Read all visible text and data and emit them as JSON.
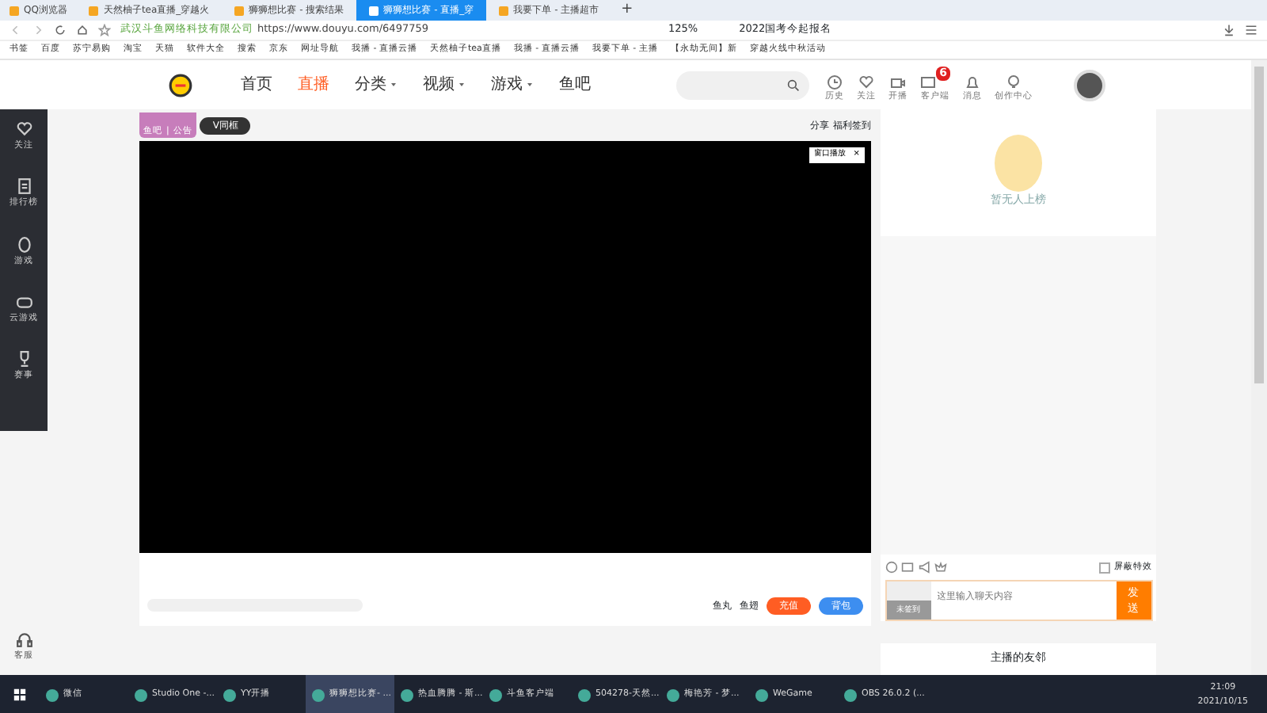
{
  "browser": {
    "tabs": [
      {
        "label": "QQ浏览器",
        "selected": false
      },
      {
        "label": "天然柚子tea直播_穿越火",
        "selected": false
      },
      {
        "label": "狮狮想比赛 - 搜索结果",
        "selected": false
      },
      {
        "label": "狮狮想比赛 - 直播_穿",
        "selected": true
      },
      {
        "label": "我要下单 - 主播超市",
        "selected": false
      }
    ],
    "new_tab": "+",
    "address": {
      "site": "武汉斗鱼网络科技有限公司",
      "url": "https://www.douyu.com/6497759"
    },
    "zoom": "125%",
    "news": "2022国考今起报名",
    "bookmarks": [
      "书签",
      "百度",
      "苏宁易购",
      "淘宝",
      "天猫",
      "软件大全",
      "搜索",
      "京东",
      "网址导航",
      "我播 - 直播云播",
      "天然柚子tea直播",
      "我播 - 直播云播",
      "我要下单 - 主播",
      "【永劫无间】新",
      "穿越火线中秋活动"
    ]
  },
  "header": {
    "nav": [
      {
        "label": "首页",
        "selected": false,
        "dropdown": false
      },
      {
        "label": "直播",
        "selected": true,
        "dropdown": false
      },
      {
        "label": "分类",
        "selected": false,
        "dropdown": true
      },
      {
        "label": "视频",
        "selected": false,
        "dropdown": true
      },
      {
        "label": "游戏",
        "selected": false,
        "dropdown": true
      },
      {
        "label": "鱼吧",
        "selected": false,
        "dropdown": false
      }
    ],
    "actions": [
      {
        "label": "历史"
      },
      {
        "label": "关注"
      },
      {
        "label": "开播"
      },
      {
        "label": "客户端",
        "badge": "6"
      },
      {
        "label": "消息"
      },
      {
        "label": "创作中心"
      }
    ]
  },
  "sidebar": [
    {
      "label": "关注"
    },
    {
      "label": "排行榜"
    },
    {
      "label": "游戏"
    },
    {
      "label": "云游戏"
    },
    {
      "label": "赛事"
    }
  ],
  "sidebar_bottom": "客服",
  "room": {
    "fishbar": "鱼吧",
    "separator": "|",
    "notice": "公告",
    "badge": "V同框",
    "share": "分享",
    "signin": "福利签到",
    "window_play": "窗口播放",
    "close": "×",
    "gifts": [
      {
        "label": "鱼丸"
      },
      {
        "label": "鱼翅"
      }
    ],
    "recharge": "充值",
    "backpack": "背包"
  },
  "chat": {
    "banner": "暂无人上榜",
    "block_effects": {
      "label": "屏蔽特效",
      "checked": false
    },
    "sign": "未签到",
    "placeholder": "这里输入聊天内容",
    "send": "发送"
  },
  "friends_title": "主播的友邻",
  "taskbar": {
    "apps": [
      {
        "label": "微信",
        "active": false
      },
      {
        "label": "Studio One -...",
        "active": false
      },
      {
        "label": "YY开播",
        "active": false
      },
      {
        "label": "狮狮想比赛- ...",
        "active": true
      },
      {
        "label": "热血腾腾 - 斯...",
        "active": false
      },
      {
        "label": "斗鱼客户端",
        "active": false
      },
      {
        "label": "504278-天然...",
        "active": false
      },
      {
        "label": "梅艳芳 - 梦...",
        "active": false
      },
      {
        "label": "WeGame",
        "active": false
      },
      {
        "label": "OBS 26.0.2 (...",
        "active": false
      }
    ],
    "time": "21:09",
    "date": "2021/10/15"
  }
}
